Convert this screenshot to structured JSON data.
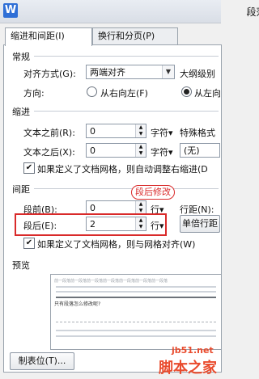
{
  "title": "段落",
  "tabs": [
    "缩进和间距(I)",
    "换行和分页(P)"
  ],
  "general": {
    "heading": "常规",
    "align_label": "对齐方式(G):",
    "align_value": "两端对齐",
    "outline_label": "大纲级别",
    "direction_label": "方向:",
    "rtl_label": "从右向左(F)",
    "ltr_label": "从左向"
  },
  "indent": {
    "heading": "缩进",
    "before_label": "文本之前(R):",
    "before_value": "0",
    "before_unit": "字符",
    "after_label": "文本之后(X):",
    "after_value": "0",
    "after_unit": "字符",
    "special_label": "特殊格式",
    "special_value": "(无)",
    "grid_checkbox": "如果定义了文档网格，则自动调整右缩进(D"
  },
  "spacing": {
    "heading": "间距",
    "before_label": "段前(B):",
    "before_value": "0",
    "before_unit": "行",
    "after_label": "段后(E):",
    "after_value": "2",
    "after_unit": "行",
    "line_label": "行距(N):",
    "line_value": "单倍行距",
    "grid_checkbox": "如果定义了文档网格，则与网格对齐(W)",
    "annotation": "段后修改"
  },
  "preview": {
    "heading": "预览",
    "sample_text": "前一段落前一段落前一段落前一段落前一段落前一段落前一段落",
    "selected_text": "只有段落怎么修改呢?"
  },
  "tab_button": "制表位(T)...",
  "watermark": {
    "site": "jb51.net",
    "brand": "脚本之家"
  }
}
